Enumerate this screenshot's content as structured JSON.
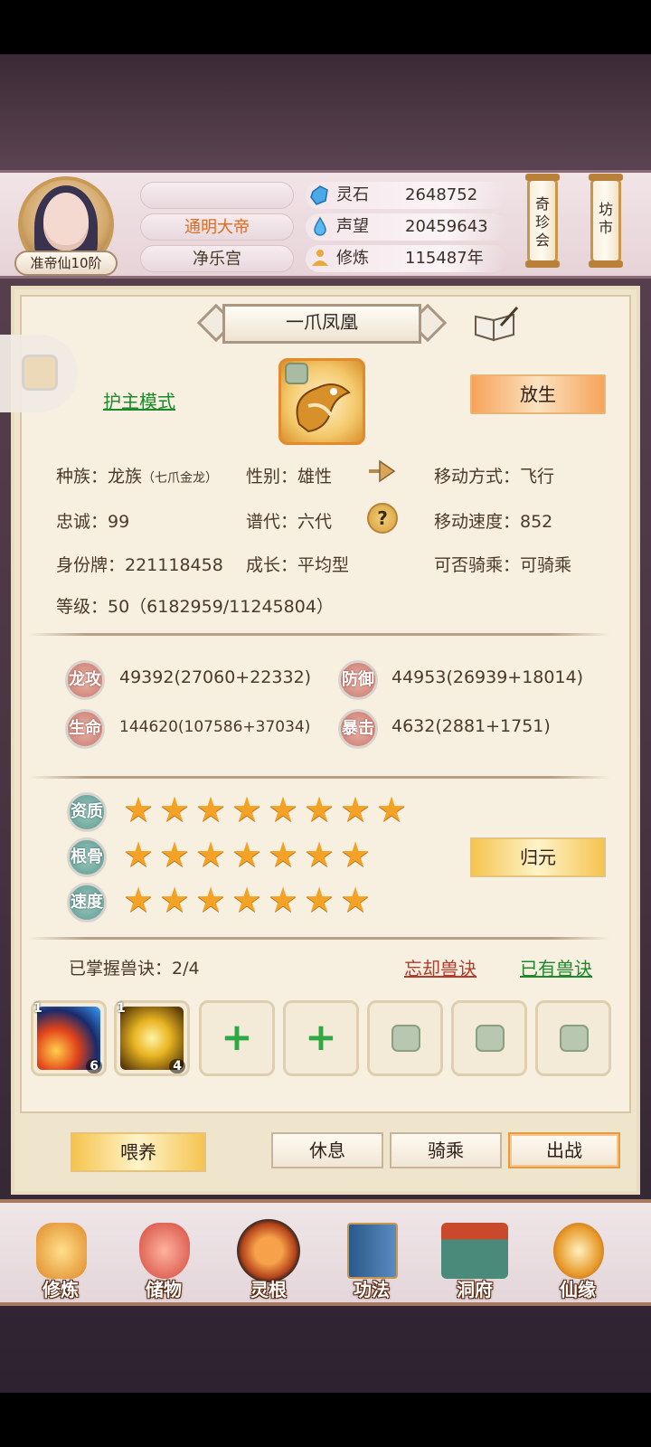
{
  "header": {
    "rank": "准帝仙10阶",
    "name_slots": [
      "",
      "通明大帝",
      "净乐宫"
    ],
    "resources": [
      {
        "label": "灵石",
        "value": "2648752",
        "icon": "spirit-stone-icon"
      },
      {
        "label": "声望",
        "value": "20459643",
        "icon": "prestige-drop-icon"
      },
      {
        "label": "修炼",
        "value": "115487年",
        "icon": "meditation-icon"
      }
    ],
    "buttons": {
      "treasure": "奇珍会",
      "market": "坊市"
    }
  },
  "pet": {
    "name": "一爪凤凰",
    "guard_mode": "护主模式",
    "release": "放生",
    "info": {
      "race": "种族：龙族",
      "race_sub": "（七爪金龙）",
      "gender": "性别：雄性",
      "move_mode": "移动方式：飞行",
      "loyalty": "忠诚：99",
      "generation": "谱代：六代",
      "move_speed": "移动速度：852",
      "id_tag": "身份牌：221118458",
      "growth": "成长：平均型",
      "rideable": "可否骑乘：可骑乘",
      "level": "等级：50（6182959/11245804）"
    },
    "help": "?"
  },
  "stats": [
    {
      "badge": "龙攻",
      "value": "49392(27060+22332)"
    },
    {
      "badge": "防御",
      "value": "44953(26939+18014)"
    },
    {
      "badge": "生命",
      "value": "144620(107586+37034)"
    },
    {
      "badge": "暴击",
      "value": "4632(2881+1751)"
    }
  ],
  "aptitude": {
    "rows": [
      {
        "label": "资质",
        "stars": 8
      },
      {
        "label": "根骨",
        "stars": 7
      },
      {
        "label": "速度",
        "stars": 7
      }
    ],
    "return_btn": "归元"
  },
  "skills": {
    "mastered": "已掌握兽诀：2/4",
    "forget": "忘却兽诀",
    "owned": "已有兽诀",
    "slots": [
      {
        "type": "skill",
        "level": "1",
        "count": "6",
        "icon": "flame-skill-icon"
      },
      {
        "type": "skill",
        "level": "1",
        "count": "4",
        "icon": "golden-beast-skill-icon"
      },
      {
        "type": "add"
      },
      {
        "type": "add"
      },
      {
        "type": "locked"
      },
      {
        "type": "locked"
      },
      {
        "type": "locked"
      }
    ],
    "plus": "+"
  },
  "actions": {
    "feed": "喂养",
    "rest": "休息",
    "ride": "骑乘",
    "battle": "出战"
  },
  "nav": [
    {
      "label": "修炼",
      "icon": "cultivate-icon"
    },
    {
      "label": "储物",
      "icon": "storage-bag-icon"
    },
    {
      "label": "灵根",
      "icon": "spirit-root-icon"
    },
    {
      "label": "功法",
      "icon": "technique-book-icon"
    },
    {
      "label": "洞府",
      "icon": "cave-mansion-icon"
    },
    {
      "label": "仙缘",
      "icon": "immortal-fate-icon"
    }
  ],
  "colors": {
    "accent_orange": "#f7a35a",
    "gold": "#f5c44f",
    "green_link": "#1c8a2a",
    "red_link": "#b53a2c",
    "star": "#f4a225"
  }
}
